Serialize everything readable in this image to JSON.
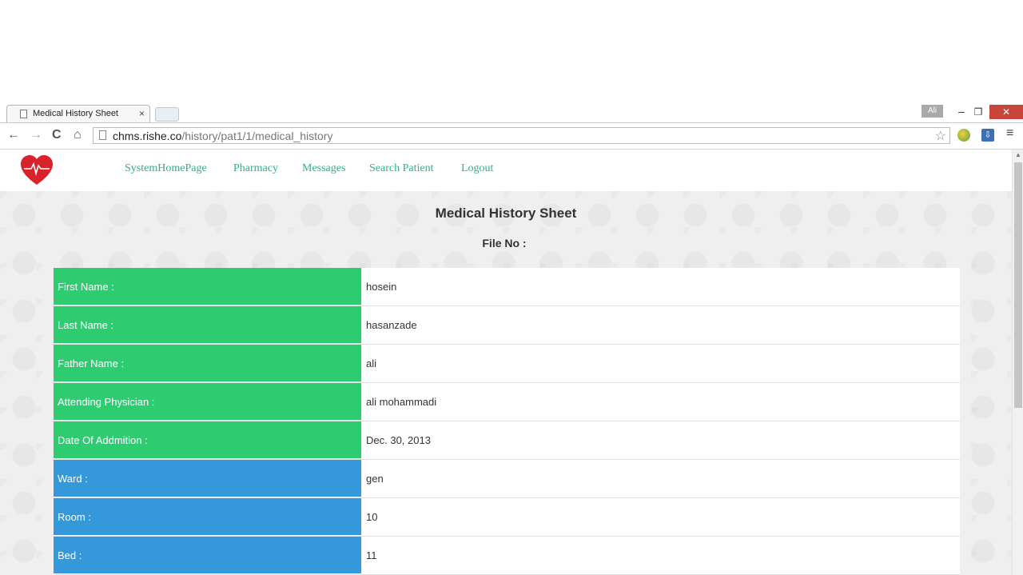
{
  "browser": {
    "tab_title": "Medical History Sheet",
    "tab_close": "×",
    "profile_badge": "Ali",
    "url_host": "chms.rishe.co",
    "url_path": "/history/pat1/1/medical_history",
    "back": "←",
    "forward": "→",
    "reload": "C",
    "home": "⌂",
    "star": "☆",
    "menu": "≡",
    "min": "–",
    "restore": "❐",
    "close": "✕",
    "down_icon": "⇩"
  },
  "nav": {
    "links": [
      "SystemHomePage",
      "Pharmacy",
      "Messages",
      "Search Patient",
      "Logout"
    ]
  },
  "sheet": {
    "title": "Medical History Sheet",
    "file_no_label": "File No :",
    "file_no_value": ""
  },
  "rows": [
    {
      "label": "First Name :",
      "value": "hosein",
      "color": "#2ecc71"
    },
    {
      "label": "Last Name :",
      "value": "hasanzade",
      "color": "#2ecc71"
    },
    {
      "label": "Father Name :",
      "value": "ali",
      "color": "#2ecc71"
    },
    {
      "label": "Attending Physician :",
      "value": "ali mohammadi",
      "color": "#2ecc71"
    },
    {
      "label": "Date Of Addmition :",
      "value": "Dec. 30, 2013",
      "color": "#2ecc71"
    },
    {
      "label": "Ward :",
      "value": "gen",
      "color": "#3498db"
    },
    {
      "label": "Room :",
      "value": "10",
      "color": "#3498db"
    },
    {
      "label": "Bed :",
      "value": "11",
      "color": "#3498db"
    }
  ]
}
